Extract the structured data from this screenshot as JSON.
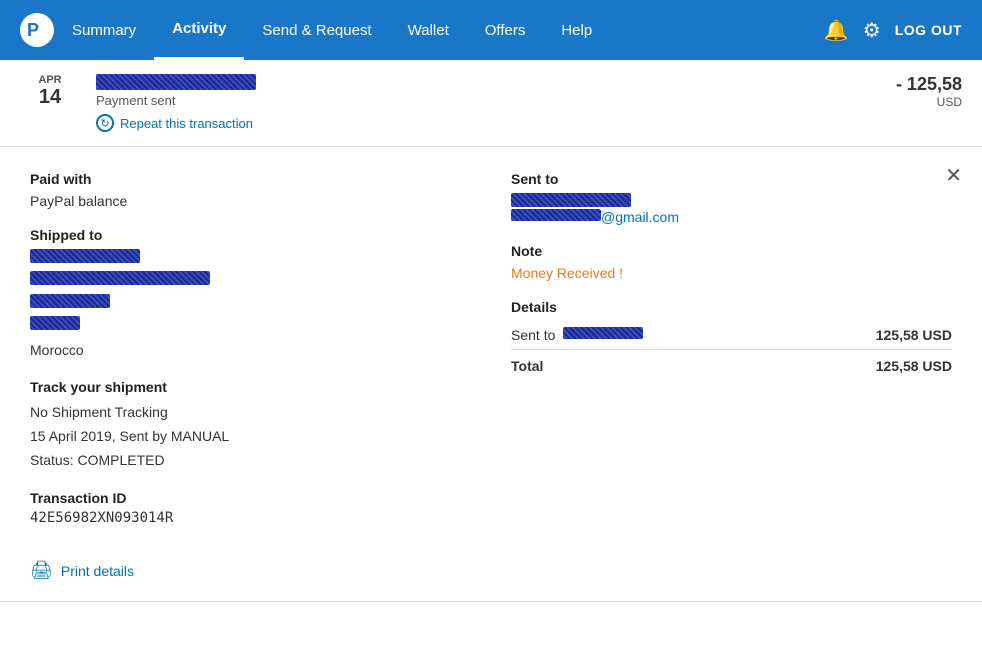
{
  "header": {
    "logo_alt": "PayPal",
    "nav": [
      {
        "id": "summary",
        "label": "Summary",
        "active": false
      },
      {
        "id": "activity",
        "label": "Activity",
        "active": true
      },
      {
        "id": "send-request",
        "label": "Send & Request",
        "active": false
      },
      {
        "id": "wallet",
        "label": "Wallet",
        "active": false
      },
      {
        "id": "offers",
        "label": "Offers",
        "active": false
      },
      {
        "id": "help",
        "label": "Help",
        "active": false
      }
    ],
    "logout_label": "LOG OUT",
    "bell_icon": "🔔",
    "gear_icon": "⚙"
  },
  "transaction": {
    "date_month": "APR",
    "date_day": "14",
    "status": "Payment sent",
    "amount": "- 125,58",
    "currency": "USD",
    "repeat_label": "Repeat this transaction"
  },
  "detail": {
    "close_icon": "✕",
    "paid_with_label": "Paid with",
    "paid_with_value": "PayPal balance",
    "shipped_to_label": "Shipped to",
    "shipped_to_lines": [
      "redacted_name",
      "redacted_address1",
      "redacted_address2",
      "redacted_address3",
      "Morocco"
    ],
    "sent_to_label": "Sent to",
    "note_label": "Note",
    "note_value": "Money Received !",
    "details_label": "Details",
    "details_sent_to_label": "Sent to",
    "details_sent_to_amount": "125,58 USD",
    "total_label": "Total",
    "total_amount": "125,58 USD",
    "track_title": "Track your shipment",
    "track_line1": "No Shipment Tracking",
    "track_line2": "15 April 2019, Sent by MANUAL",
    "track_status": "Status: COMPLETED",
    "txn_id_label": "Transaction ID",
    "txn_id_value": "42E56982XN093014R",
    "print_label": "Print details"
  }
}
